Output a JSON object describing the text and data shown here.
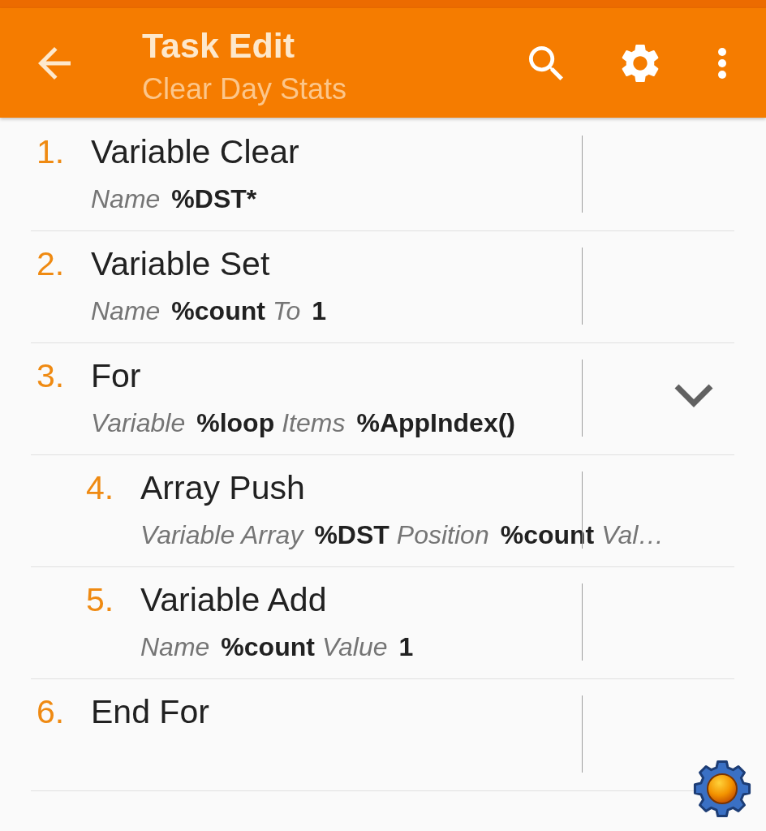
{
  "toolbar": {
    "title": "Task Edit",
    "subtitle": "Clear Day Stats"
  },
  "actions": [
    {
      "number": "1.",
      "name": "Variable Clear",
      "params": [
        {
          "label": "Name",
          "value": "%DST*"
        }
      ]
    },
    {
      "number": "2.",
      "name": "Variable Set",
      "params": [
        {
          "label": "Name",
          "value": "%count"
        },
        {
          "label": "To",
          "value": "1"
        }
      ]
    },
    {
      "number": "3.",
      "name": "For",
      "expanded": true,
      "params": [
        {
          "label": "Variable",
          "value": "%loop"
        },
        {
          "label": "Items",
          "value": "%AppIndex()"
        }
      ],
      "children": [
        {
          "number": "4.",
          "name": "Array Push",
          "params": [
            {
              "label": "Variable Array",
              "value": "%DST"
            },
            {
              "label": "Position",
              "value": "%count"
            },
            {
              "label": "Val…"
            }
          ]
        },
        {
          "number": "5.",
          "name": "Variable Add",
          "params": [
            {
              "label": "Name",
              "value": "%count"
            },
            {
              "label": "Value",
              "value": "1"
            }
          ]
        }
      ]
    },
    {
      "number": "6.",
      "name": "End For"
    }
  ]
}
